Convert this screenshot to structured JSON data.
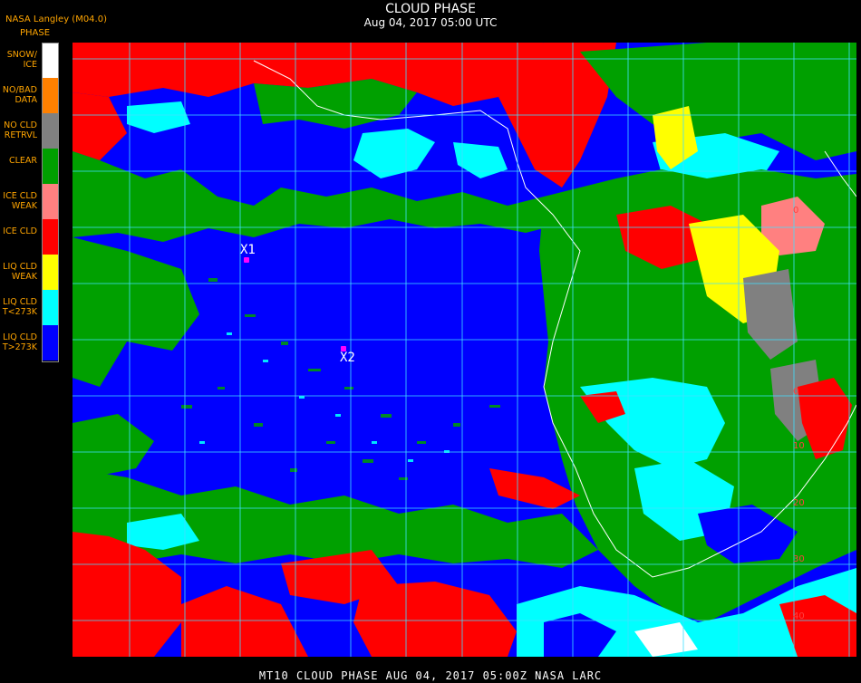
{
  "header": {
    "title": "CLOUD PHASE",
    "subtitle": "Aug 04, 2017 05:00 UTC"
  },
  "source": "NASA Langley (M04.0)",
  "legend": {
    "heading": "PHASE",
    "items": [
      {
        "label": "SNOW/\nICE",
        "color": "#ffffff"
      },
      {
        "label": "NO/BAD\nDATA",
        "color": "#ff8000"
      },
      {
        "label": "NO CLD\nRETRVL",
        "color": "#808080"
      },
      {
        "label": "CLEAR",
        "color": "#00a000"
      },
      {
        "label": "ICE CLD\nWEAK",
        "color": "#ff8080"
      },
      {
        "label": "ICE CLD",
        "color": "#ff0000"
      },
      {
        "label": "LIQ CLD\nWEAK",
        "color": "#ffff00"
      },
      {
        "label": "LIQ CLD\nT<273K",
        "color": "#00ffff"
      },
      {
        "label": "LIQ CLD\nT>273K",
        "color": "#0000ff"
      }
    ]
  },
  "markers": [
    {
      "id": "x1",
      "label": "X1"
    },
    {
      "id": "x2",
      "label": "X2"
    }
  ],
  "map_labels": [
    "0",
    "0",
    "10",
    "20",
    "30",
    "40"
  ],
  "footer": {
    "text": "MT10  CLOUD PHASE   AUG 04, 2017 05:00Z  NASA LARC"
  }
}
